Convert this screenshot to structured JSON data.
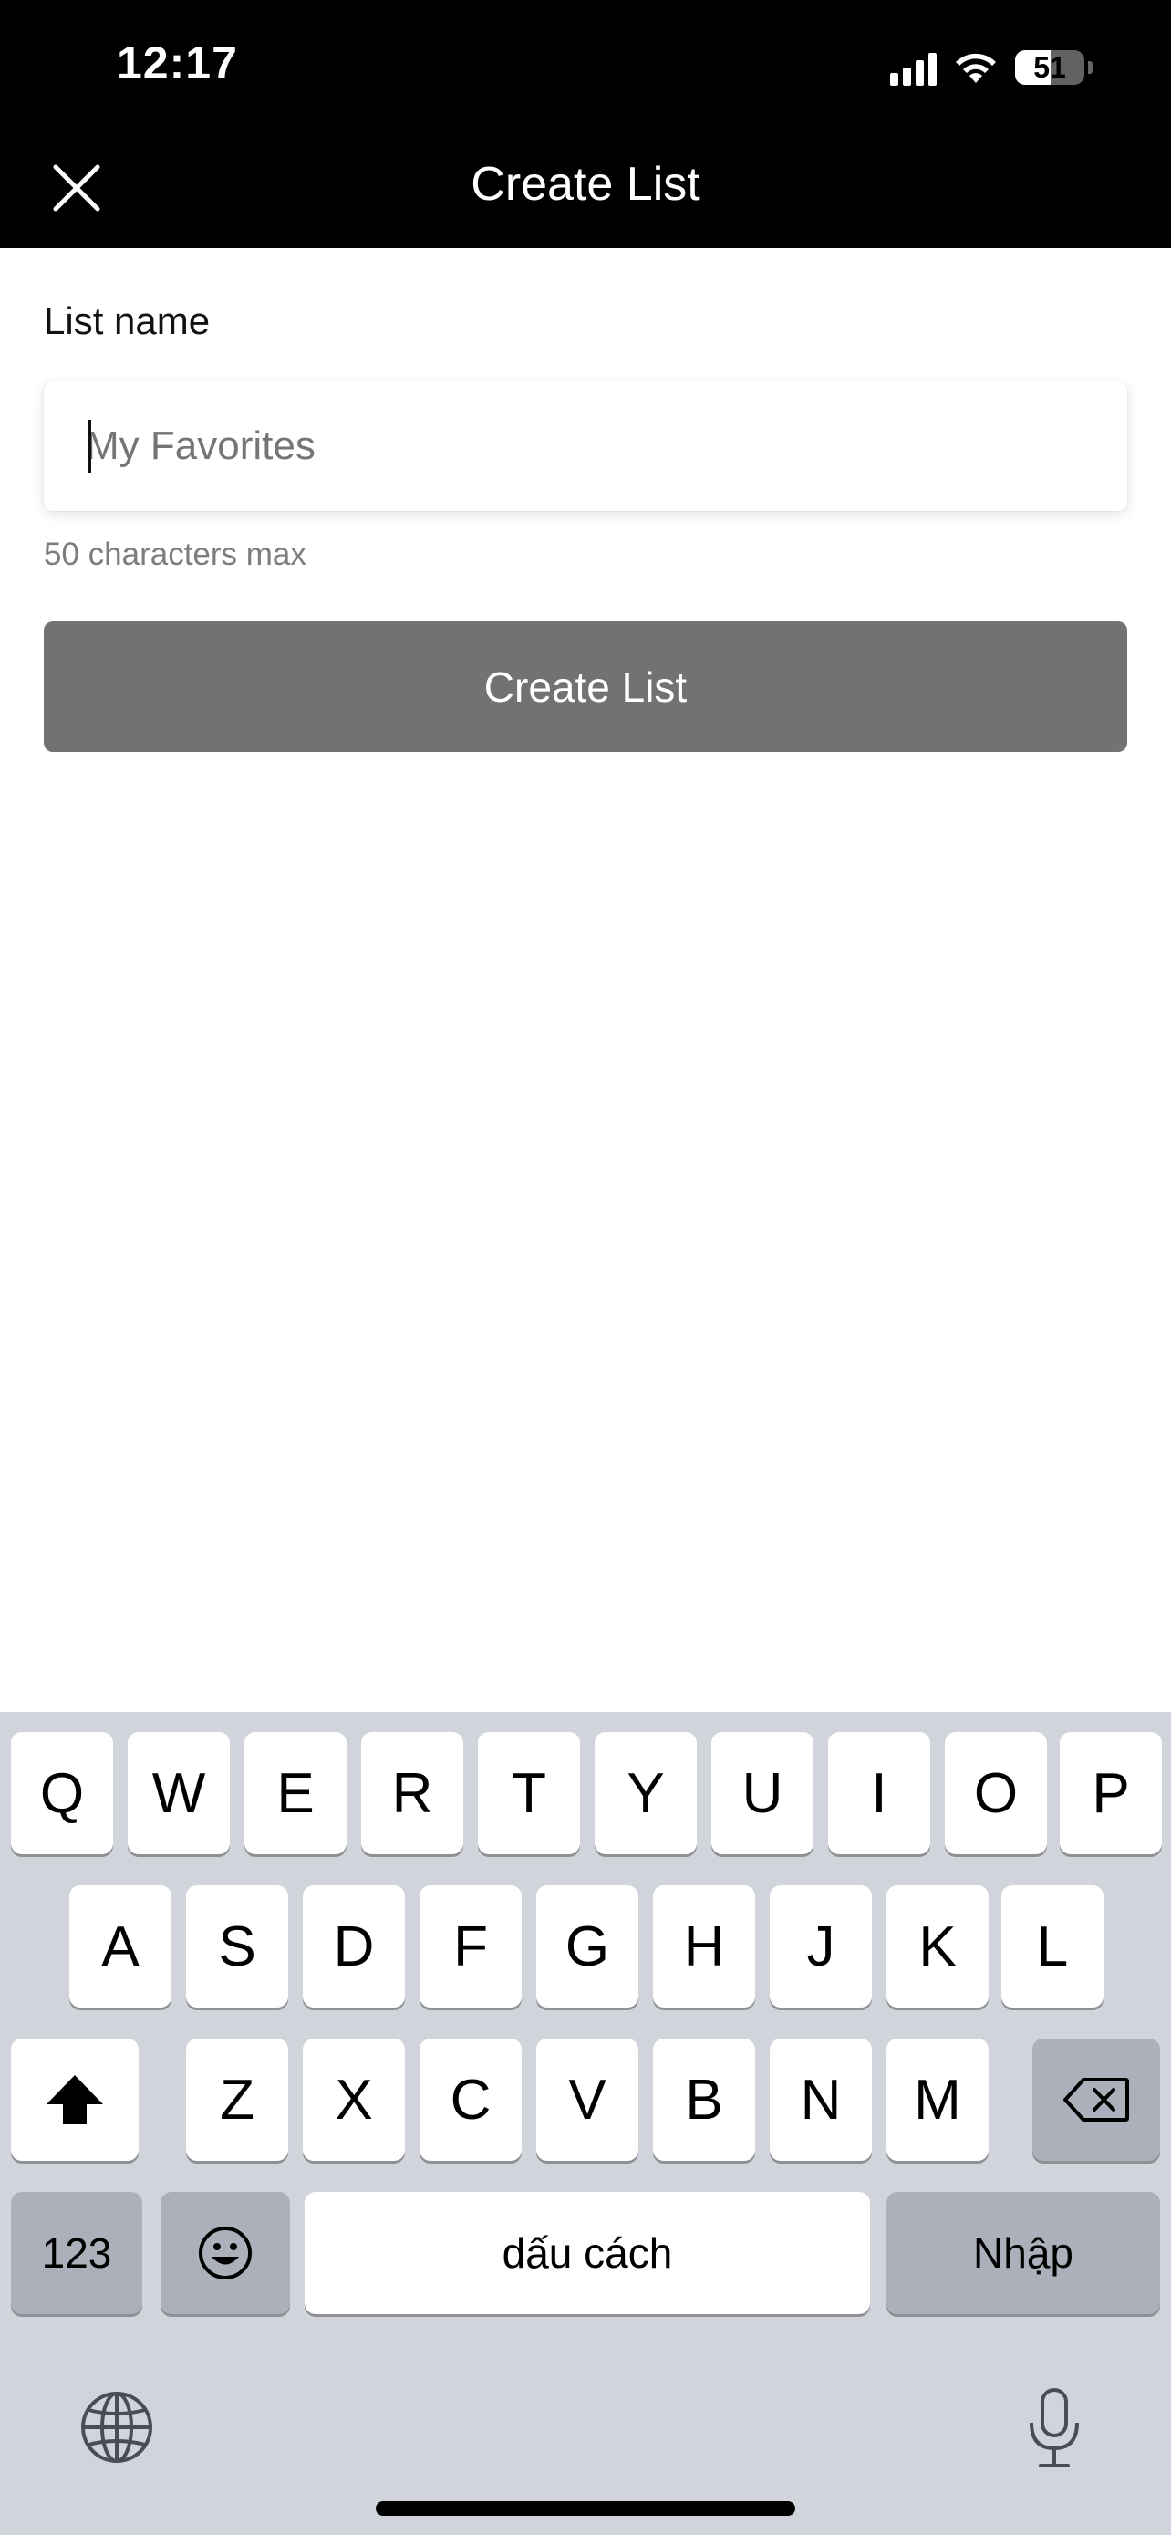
{
  "status_bar": {
    "time": "12:17",
    "battery": "51"
  },
  "header": {
    "title": "Create List",
    "close_icon": "close-icon"
  },
  "form": {
    "label": "List name",
    "input_value": "",
    "input_placeholder": "My Favorites",
    "hint": "50 characters max",
    "submit_label": "Create List"
  },
  "keyboard": {
    "row1": [
      "Q",
      "W",
      "E",
      "R",
      "T",
      "Y",
      "U",
      "I",
      "O",
      "P"
    ],
    "row2": [
      "A",
      "S",
      "D",
      "F",
      "G",
      "H",
      "J",
      "K",
      "L"
    ],
    "row3": [
      "Z",
      "X",
      "C",
      "V",
      "B",
      "N",
      "M"
    ],
    "numbers_key": "123",
    "space_key": "dấu cách",
    "return_key": "Nhập",
    "icons": [
      "shift-icon",
      "backspace-icon",
      "emoji-icon",
      "globe-icon",
      "microphone-icon"
    ]
  },
  "colors": {
    "header_bg": "#000000",
    "button_bg": "#727272",
    "keyboard_bg": "#d1d4da"
  }
}
